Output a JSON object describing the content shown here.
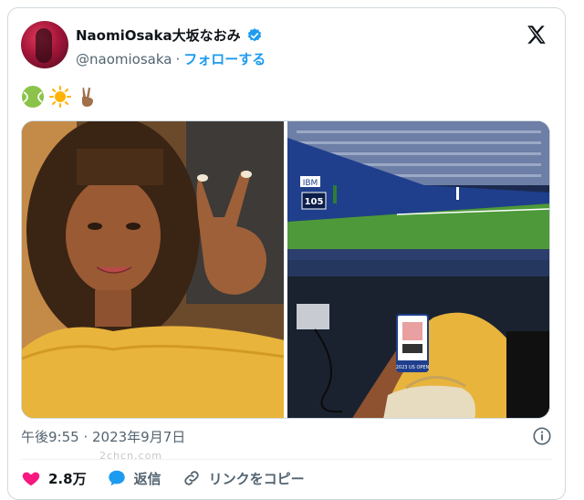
{
  "author": {
    "display_name": "NaomiOsaka大坂なおみ",
    "handle": "@naomiosaka",
    "separator": "·",
    "follow_label": "フォローする",
    "verified": true
  },
  "post": {
    "emojis": [
      "tennis-ball-emoji",
      "sun-emoji",
      "victory-hand-emoji"
    ],
    "timestamp": "午後9:55 · 2023年9月7日"
  },
  "media": {
    "count": 2,
    "left_photo": "selfie in yellow top",
    "right_photo": "view of tennis stadium court",
    "court_signs": {
      "ibm": "IBM",
      "speed": "105",
      "speed_unit": "SERVE SPEED",
      "badge": "2023 US OPEN"
    }
  },
  "actions": {
    "like_count": "2.8万",
    "reply_label": "返信",
    "copy_link_label": "リンクをコピー"
  },
  "watermark": "2chcn.com",
  "colors": {
    "accent": "#1d9bf0",
    "like": "#f91880",
    "muted": "#536471",
    "border": "#cfd9de"
  }
}
